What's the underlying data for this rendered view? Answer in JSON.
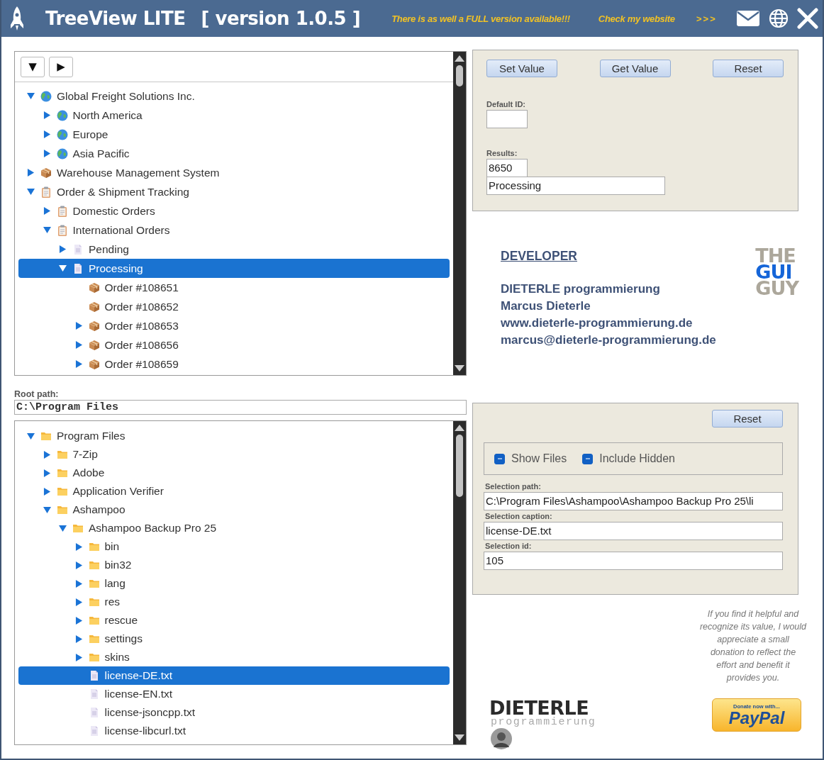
{
  "title_bar": {
    "title": "TreeView LITE",
    "version": "[ version 1.0.5 ]",
    "promo": "There is as well a FULL version available!!!",
    "website_link": "Check my website",
    "arrows": ">>>"
  },
  "top_tree": {
    "toolbar": [
      "▼",
      "▶"
    ],
    "nodes": [
      {
        "label": "Global Freight Solutions Inc.",
        "kind": "globe",
        "expanded": true,
        "selected": false,
        "children": [
          {
            "label": "North America",
            "kind": "globe",
            "expanded": false,
            "selected": false
          },
          {
            "label": "Europe",
            "kind": "globe",
            "expanded": false,
            "selected": false
          },
          {
            "label": "Asia Pacific",
            "kind": "globe",
            "expanded": false,
            "selected": false
          }
        ]
      },
      {
        "label": "Warehouse Management System",
        "kind": "package",
        "expanded": false,
        "selected": false
      },
      {
        "label": "Order & Shipment Tracking",
        "kind": "clipboard",
        "expanded": true,
        "selected": false,
        "children": [
          {
            "label": "Domestic Orders",
            "kind": "clipboard",
            "expanded": false,
            "selected": false
          },
          {
            "label": "International Orders",
            "kind": "clipboard",
            "expanded": true,
            "selected": false,
            "children": [
              {
                "label": "Pending",
                "kind": "document",
                "expanded": false,
                "selected": false
              },
              {
                "label": "Processing",
                "kind": "document",
                "expanded": true,
                "selected": true,
                "children": [
                  {
                    "label": "Order #108651",
                    "kind": "package",
                    "selected": false
                  },
                  {
                    "label": "Order #108652",
                    "kind": "package",
                    "selected": false
                  },
                  {
                    "label": "Order #108653",
                    "kind": "package",
                    "expanded": false,
                    "selected": false
                  },
                  {
                    "label": "Order #108656",
                    "kind": "package",
                    "expanded": false,
                    "selected": false
                  },
                  {
                    "label": "Order #108659",
                    "kind": "package",
                    "expanded": false,
                    "selected": false
                  }
                ]
              }
            ]
          }
        ]
      }
    ]
  },
  "value_panel": {
    "buttons": [
      "Set Value",
      "Get Value",
      "Reset"
    ],
    "default_id_label": "Default ID:",
    "results_label": "Results:",
    "result_id": "8650",
    "result_caption": "Processing"
  },
  "developer": {
    "heading": "DEVELOPER",
    "lines": [
      "DIETERLE programmierung",
      "Marcus Dieterle",
      "www.dieterle-programmierung.de",
      "marcus@dieterle-programmierung.de"
    ]
  },
  "gui_guy_logo": [
    "THE",
    "GUI",
    "GUY"
  ],
  "root_path": {
    "label": "Root path:",
    "value": "C:\\Program Files"
  },
  "file_tree": {
    "nodes": [
      {
        "label": "Program Files",
        "kind": "folder",
        "expanded": true,
        "selected": false,
        "children": [
          {
            "label": "7-Zip",
            "kind": "folder",
            "expanded": false,
            "selected": false
          },
          {
            "label": "Adobe",
            "kind": "folder",
            "expanded": false,
            "selected": false
          },
          {
            "label": "Application Verifier",
            "kind": "folder",
            "expanded": false,
            "selected": false
          },
          {
            "label": "Ashampoo",
            "kind": "folder",
            "expanded": true,
            "selected": false,
            "children": [
              {
                "label": "Ashampoo Backup Pro 25",
                "kind": "folder",
                "expanded": true,
                "selected": false,
                "children": [
                  {
                    "label": "bin",
                    "kind": "folder",
                    "expanded": false,
                    "selected": false
                  },
                  {
                    "label": "bin32",
                    "kind": "folder",
                    "expanded": false,
                    "selected": false
                  },
                  {
                    "label": "lang",
                    "kind": "folder",
                    "expanded": false,
                    "selected": false
                  },
                  {
                    "label": "res",
                    "kind": "folder",
                    "expanded": false,
                    "selected": false
                  },
                  {
                    "label": "rescue",
                    "kind": "folder",
                    "expanded": false,
                    "selected": false
                  },
                  {
                    "label": "settings",
                    "kind": "folder",
                    "expanded": false,
                    "selected": false
                  },
                  {
                    "label": "skins",
                    "kind": "folder",
                    "expanded": false,
                    "selected": false
                  },
                  {
                    "label": "license-DE.txt",
                    "kind": "document",
                    "selected": true
                  },
                  {
                    "label": "license-EN.txt",
                    "kind": "document",
                    "selected": false
                  },
                  {
                    "label": "license-jsoncpp.txt",
                    "kind": "document",
                    "selected": false
                  },
                  {
                    "label": "license-libcurl.txt",
                    "kind": "document",
                    "selected": false
                  }
                ]
              }
            ]
          }
        ]
      }
    ]
  },
  "file_panel": {
    "reset": "Reset",
    "options": [
      {
        "label": "Show Files",
        "checked": true
      },
      {
        "label": "Include Hidden",
        "checked": true
      }
    ],
    "fields": [
      {
        "label": "Selection path:",
        "value": "C:\\Program Files\\Ashampoo\\Ashampoo Backup Pro 25\\li"
      },
      {
        "label": "Selection caption:",
        "value": "license-DE.txt"
      },
      {
        "label": "Selection id:",
        "value": "105"
      }
    ]
  },
  "donation": {
    "text": "If you find it helpful and recognize its value, I would appreciate a small donation to reflect the effort and benefit it provides you."
  },
  "dieterle_logo": {
    "name": "DIETERLE",
    "tagline": "programmierung"
  },
  "paypal_button": {
    "caption": "Donate now with...",
    "brand": "PayPal"
  }
}
